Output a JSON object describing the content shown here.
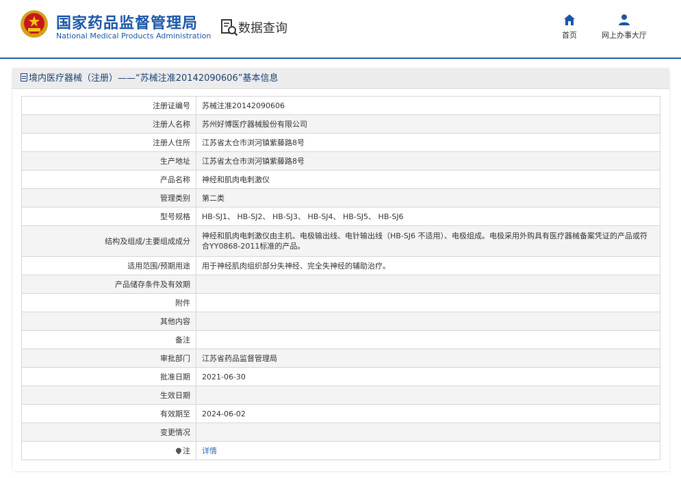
{
  "header": {
    "brand_cn": "国家药品监督管理局",
    "brand_en": "National Medical Products Administration",
    "query_title": "数据查询",
    "nav": [
      {
        "label": "首页",
        "icon": "home-icon"
      },
      {
        "label": "网上办事大厅",
        "icon": "user-icon"
      }
    ]
  },
  "panel": {
    "title": "境内医疗器械（注册）——“苏械注准20142090606”基本信息"
  },
  "table": {
    "rows": [
      {
        "label": "注册证编号",
        "value": "苏械注准20142090606"
      },
      {
        "label": "注册人名称",
        "value": "苏州好博医疗器械股份有限公司"
      },
      {
        "label": "注册人住所",
        "value": "江苏省太仓市浏河镇紫藤路8号"
      },
      {
        "label": "生产地址",
        "value": "江苏省太仓市浏河镇紫藤路8号"
      },
      {
        "label": "产品名称",
        "value": "神经和肌肉电刺激仪"
      },
      {
        "label": "管理类别",
        "value": "第二类"
      },
      {
        "label": "型号规格",
        "value": "HB-SJ1、 HB-SJ2、 HB-SJ3、 HB-SJ4、 HB-SJ5、 HB-SJ6"
      },
      {
        "label": "结构及组成/主要组成成分",
        "value": "神经和肌肉电刺激仪由主机、电极输出线、电针输出线（HB-SJ6 不适用）、电极组成。电极采用外购具有医疗器械备案凭证的产品或符合YY0868-2011标准的产品。"
      },
      {
        "label": "适用范围/预期用途",
        "value": "用于神经肌肉组织部分失神经、完全失神经的辅助治疗。"
      },
      {
        "label": "产品储存条件及有效期",
        "value": ""
      },
      {
        "label": "附件",
        "value": ""
      },
      {
        "label": "其他内容",
        "value": ""
      },
      {
        "label": "备注",
        "value": ""
      },
      {
        "label": "审批部门",
        "value": "江苏省药品监督管理局"
      },
      {
        "label": "批准日期",
        "value": "2021-06-30"
      },
      {
        "label": "生效日期",
        "value": ""
      },
      {
        "label": "有效期至",
        "value": "2024-06-02"
      },
      {
        "label": "变更情况",
        "value": ""
      },
      {
        "label": "注",
        "value": "详情"
      }
    ]
  },
  "colors": {
    "brand": "#1a56a6",
    "accent_border": "#1c64a8",
    "link": "#2a6bbf"
  }
}
